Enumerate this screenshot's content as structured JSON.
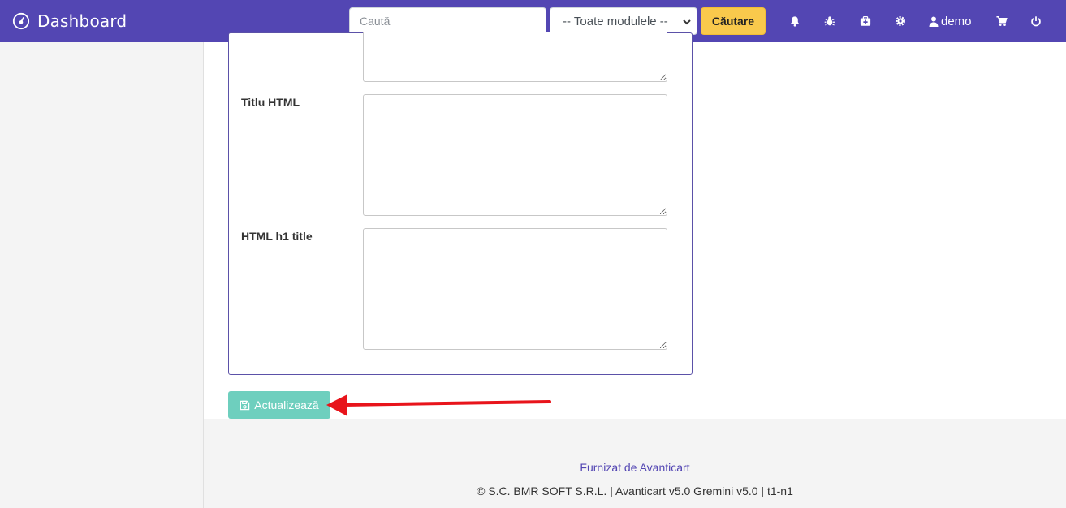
{
  "header": {
    "brand_title": "Dashboard",
    "search": {
      "placeholder": "Caută",
      "value": ""
    },
    "module_select": {
      "selected": "-- Toate modulele --"
    },
    "search_button_label": "Căutare",
    "user_label": "demo",
    "icons": [
      "bell-icon",
      "bug-icon",
      "medkit-icon",
      "gear-icon",
      "user-icon",
      "cart-icon",
      "power-icon"
    ]
  },
  "form": {
    "fields": [
      {
        "label": "",
        "value": ""
      },
      {
        "label": "Titlu HTML",
        "value": ""
      },
      {
        "label": "HTML h1 title",
        "value": ""
      }
    ],
    "update_button_label": "Actualizează"
  },
  "footer": {
    "powered_by": "Furnizat de Avanticart",
    "copyright": "© S.C. BMR SOFT S.R.L. | Avanticart v5.0 Gremini v5.0 | t1-n1"
  },
  "colors": {
    "header_bg": "#5346b3",
    "search_button": "#f9c94c",
    "update_button": "#6ecfbe",
    "panel_border": "#5b51a8",
    "annotation_arrow": "#e8141b"
  }
}
